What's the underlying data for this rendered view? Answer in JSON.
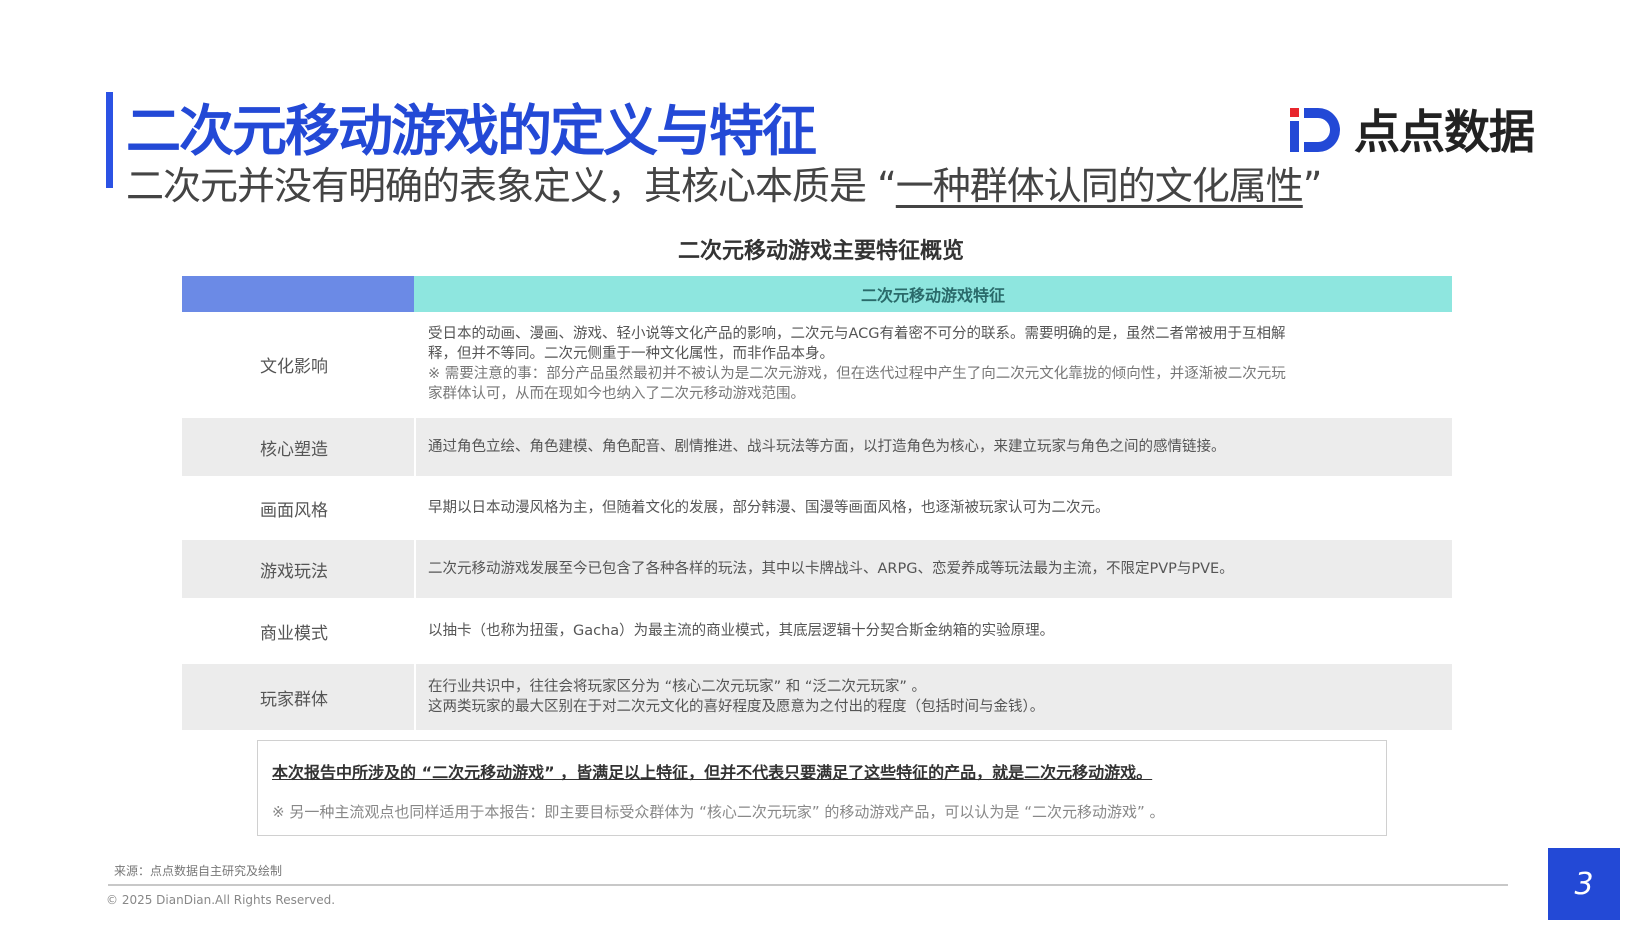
{
  "header": {
    "title": "二次元移动游戏的定义与特征",
    "subtitle_prefix": "二次元并没有明确的表象定义，其核心本质是 “",
    "subtitle_emphasis": "一种群体认同的文化属性",
    "subtitle_suffix": "”"
  },
  "logo": {
    "text": "点点数据",
    "icon": "diandian-logo-icon",
    "colors": {
      "blue": "#2349d6",
      "red": "#e8262d"
    }
  },
  "table": {
    "caption": "二次元移动游戏主要特征概览",
    "header": {
      "col1": "",
      "col2": "二次元移动游戏特征"
    },
    "rows": [
      {
        "label": "文化影响",
        "lines": [
          "受日本的动画、漫画、游戏、轻小说等文化产品的影响，二次元与ACG有着密不可分的联系。需要明确的是，虽然二者常被用于互相解",
          "释，但并不等同。二次元侧重于一种文化属性，而非作品本身。"
        ],
        "note": [
          "※ 需要注意的事：部分产品虽然最初并不被认为是二次元游戏，但在迭代过程中产生了向二次元文化靠拢的倾向性，并逐渐被二次元玩",
          "家群体认可，从而在现如今也纳入了二次元移动游戏范围。"
        ]
      },
      {
        "label": "核心塑造",
        "lines": [
          "通过角色立绘、角色建模、角色配音、剧情推进、战斗玩法等方面，以打造角色为核心，来建立玩家与角色之间的感情链接。"
        ],
        "note": []
      },
      {
        "label": "画面风格",
        "lines": [
          "早期以日本动漫风格为主，但随着文化的发展，部分韩漫、国漫等画面风格，也逐渐被玩家认可为二次元。"
        ],
        "note": []
      },
      {
        "label": "游戏玩法",
        "lines": [
          "二次元移动游戏发展至今已包含了各种各样的玩法，其中以卡牌战斗、ARPG、恋爱养成等玩法最为主流，不限定PVP与PVE。"
        ],
        "note": []
      },
      {
        "label": "商业模式",
        "lines": [
          "以抽卡（也称为扭蛋，Gacha）为最主流的商业模式，其底层逻辑十分契合斯金纳箱的实验原理。"
        ],
        "note": []
      },
      {
        "label": "玩家群体",
        "lines": [
          "在行业共识中，往往会将玩家区分为 “核心二次元玩家” 和 “泛二次元玩家” 。",
          "这两类玩家的最大区别在于对二次元文化的喜好程度及愿意为之付出的程度（包括时间与金钱）。"
        ],
        "note": []
      }
    ]
  },
  "summary": {
    "bold": "本次报告中所涉及的 “二次元移动游戏” ，皆满足以上特征，但并不代表只要满足了这些特征的产品，就是二次元移动游戏。",
    "note": "※ 另一种主流观点也同样适用于本报告：即主要目标受众群体为 “核心二次元玩家” 的移动游戏产品，可以认为是 “二次元移动游戏” 。"
  },
  "footer": {
    "source": "来源：点点数据自主研究及绘制",
    "copyright": "© 2025 DianDian.All Rights Reserved.",
    "page": "3"
  }
}
